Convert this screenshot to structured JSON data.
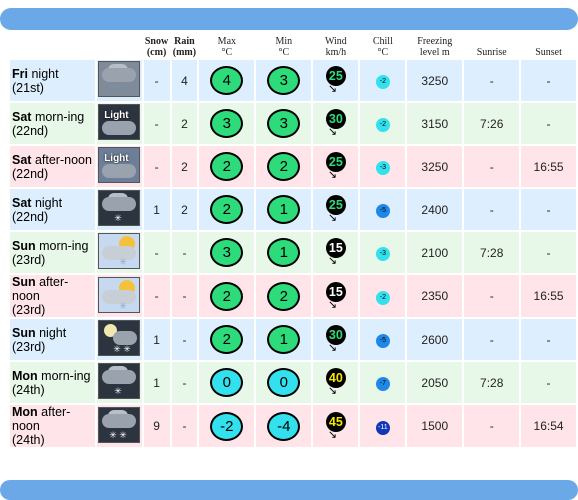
{
  "headers": {
    "snow": [
      "Snow",
      "(cm)"
    ],
    "rain": [
      "Rain",
      "(mm)"
    ],
    "max": [
      "Max",
      "°C"
    ],
    "min": [
      "Min",
      "°C"
    ],
    "wind": [
      "Wind",
      "km/h"
    ],
    "chill": [
      "Chill",
      "°C"
    ],
    "freezing": [
      "Freezing",
      "level m"
    ],
    "sunrise": "Sunrise",
    "sunset": "Sunset"
  },
  "rows": [
    {
      "day": "Fri",
      "period": "night",
      "date": "(21st)",
      "snow": "-",
      "rain": "4",
      "max": "4",
      "min": "3",
      "wind": "25",
      "chill": "-2",
      "freezing": "3250",
      "sunrise": "-",
      "sunset": "-",
      "icon": "heavy-cloud-rain-icon"
    },
    {
      "day": "Sat",
      "period": "morn-ing",
      "date": "(22nd)",
      "snow": "-",
      "rain": "2",
      "max": "3",
      "min": "3",
      "wind": "30",
      "chill": "-2",
      "freezing": "3150",
      "sunrise": "7:26",
      "sunset": "-",
      "icon": "light-rain-icon",
      "icon_text": "Light"
    },
    {
      "day": "Sat",
      "period": "after-noon",
      "date": "(22nd)",
      "snow": "-",
      "rain": "2",
      "max": "2",
      "min": "2",
      "wind": "25",
      "chill": "-3",
      "freezing": "3250",
      "sunrise": "-",
      "sunset": "16:55",
      "icon": "light-rain-icon",
      "icon_text": "Light"
    },
    {
      "day": "Sat",
      "period": "night",
      "date": "(22nd)",
      "snow": "1",
      "rain": "2",
      "max": "2",
      "min": "1",
      "wind": "25",
      "chill": "-5",
      "freezing": "2400",
      "sunrise": "-",
      "sunset": "-",
      "icon": "cloud-snow-icon"
    },
    {
      "day": "Sun",
      "period": "morn-ing",
      "date": "(23rd)",
      "snow": "-",
      "rain": "-",
      "max": "3",
      "min": "1",
      "wind": "15",
      "chill": "-3",
      "freezing": "2100",
      "sunrise": "7:28",
      "sunset": "-",
      "icon": "sun-cloud-icon"
    },
    {
      "day": "Sun",
      "period": "after-noon",
      "date": "(23rd)",
      "snow": "-",
      "rain": "-",
      "max": "2",
      "min": "2",
      "wind": "15",
      "chill": "-2",
      "freezing": "2350",
      "sunrise": "-",
      "sunset": "16:55",
      "icon": "sun-cloud-icon"
    },
    {
      "day": "Sun",
      "period": "night",
      "date": "(23rd)",
      "snow": "1",
      "rain": "-",
      "max": "2",
      "min": "1",
      "wind": "30",
      "chill": "-5",
      "freezing": "2600",
      "sunrise": "-",
      "sunset": "-",
      "icon": "moon-snow-icon"
    },
    {
      "day": "Mon",
      "period": "morn-ing",
      "date": "(24th)",
      "snow": "1",
      "rain": "-",
      "max": "0",
      "min": "0",
      "wind": "40",
      "chill": "-7",
      "freezing": "2050",
      "sunrise": "7:28",
      "sunset": "-",
      "icon": "cloud-snow-icon"
    },
    {
      "day": "Mon",
      "period": "after-noon",
      "date": "(24th)",
      "snow": "9",
      "rain": "-",
      "max": "-2",
      "min": "-4",
      "wind": "45",
      "chill": "-11",
      "freezing": "1500",
      "sunrise": "-",
      "sunset": "16:54",
      "icon": "heavy-snow-icon"
    }
  ],
  "colors": {
    "band": "#6aa8e8",
    "night_row": "#ddeeff",
    "morning_row": "#e8f8e8",
    "afternoon_row": "#ffe4ea",
    "temp_green": "#2ddb7a",
    "temp_cyan": "#32e0ee"
  }
}
